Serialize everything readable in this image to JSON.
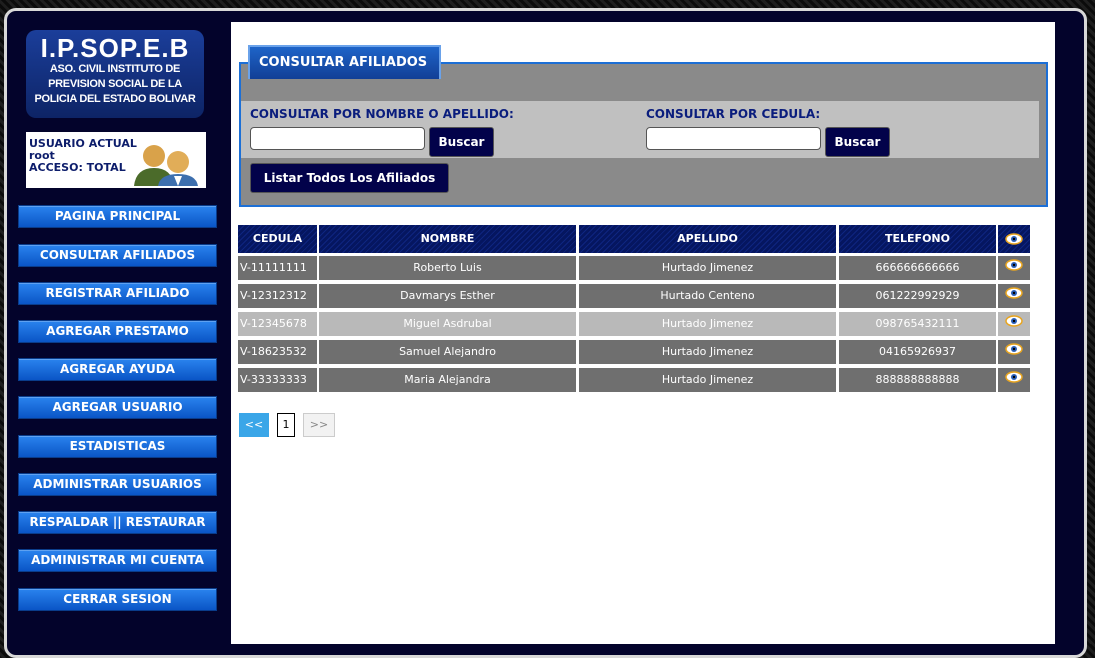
{
  "logo": {
    "title": "I.P.SOP.E.B",
    "line1": "ASO. CIVIL INSTITUTO DE",
    "line2": "PREVISION SOCIAL DE LA",
    "line3": "POLICIA DEL ESTADO BOLIVAR"
  },
  "user": {
    "label": "USUARIO ACTUAL",
    "name": "root",
    "access": "ACCESO: TOTAL"
  },
  "nav": [
    "PAGINA PRINCIPAL",
    "CONSULTAR AFILIADOS",
    "REGISTRAR AFILIADO",
    "AGREGAR PRESTAMO",
    "AGREGAR AYUDA",
    "AGREGAR USUARIO",
    "ESTADISTICAS",
    "ADMINISTRAR USUARIOS",
    "RESPALDAR || RESTAURAR",
    "ADMINISTRAR MI CUENTA",
    "CERRAR SESION"
  ],
  "search": {
    "title": "CONSULTAR AFILIADOS",
    "by_name_label": "CONSULTAR POR NOMBRE O APELLIDO:",
    "by_id_label": "CONSULTAR POR CEDULA:",
    "name_value": "",
    "id_value": "",
    "search_button": "Buscar",
    "list_all_button": "Listar Todos Los Afiliados"
  },
  "table": {
    "headers": [
      "CEDULA",
      "NOMBRE",
      "APELLIDO",
      "TELEFONO"
    ],
    "rows": [
      {
        "cedula": "V-11111111",
        "nombre": "Roberto Luis",
        "apellido": "Hurtado Jimenez",
        "telefono": "666666666666"
      },
      {
        "cedula": "V-12312312",
        "nombre": "Davmarys Esther",
        "apellido": "Hurtado Centeno",
        "telefono": "061222992929"
      },
      {
        "cedula": "V-12345678",
        "nombre": "Miguel Asdrubal",
        "apellido": "Hurtado Jimenez",
        "telefono": "098765432111"
      },
      {
        "cedula": "V-18623532",
        "nombre": "Samuel Alejandro",
        "apellido": "Hurtado Jimenez",
        "telefono": "04165926937"
      },
      {
        "cedula": "V-33333333",
        "nombre": "Maria Alejandra",
        "apellido": "Hurtado Jimenez",
        "telefono": "888888888888"
      }
    ],
    "highlighted_row": 2,
    "row_color": "#6f6f6f",
    "highlight_color": "#b9b9b9"
  },
  "pagination": {
    "prev": "<<",
    "current": "1",
    "next": ">>"
  }
}
